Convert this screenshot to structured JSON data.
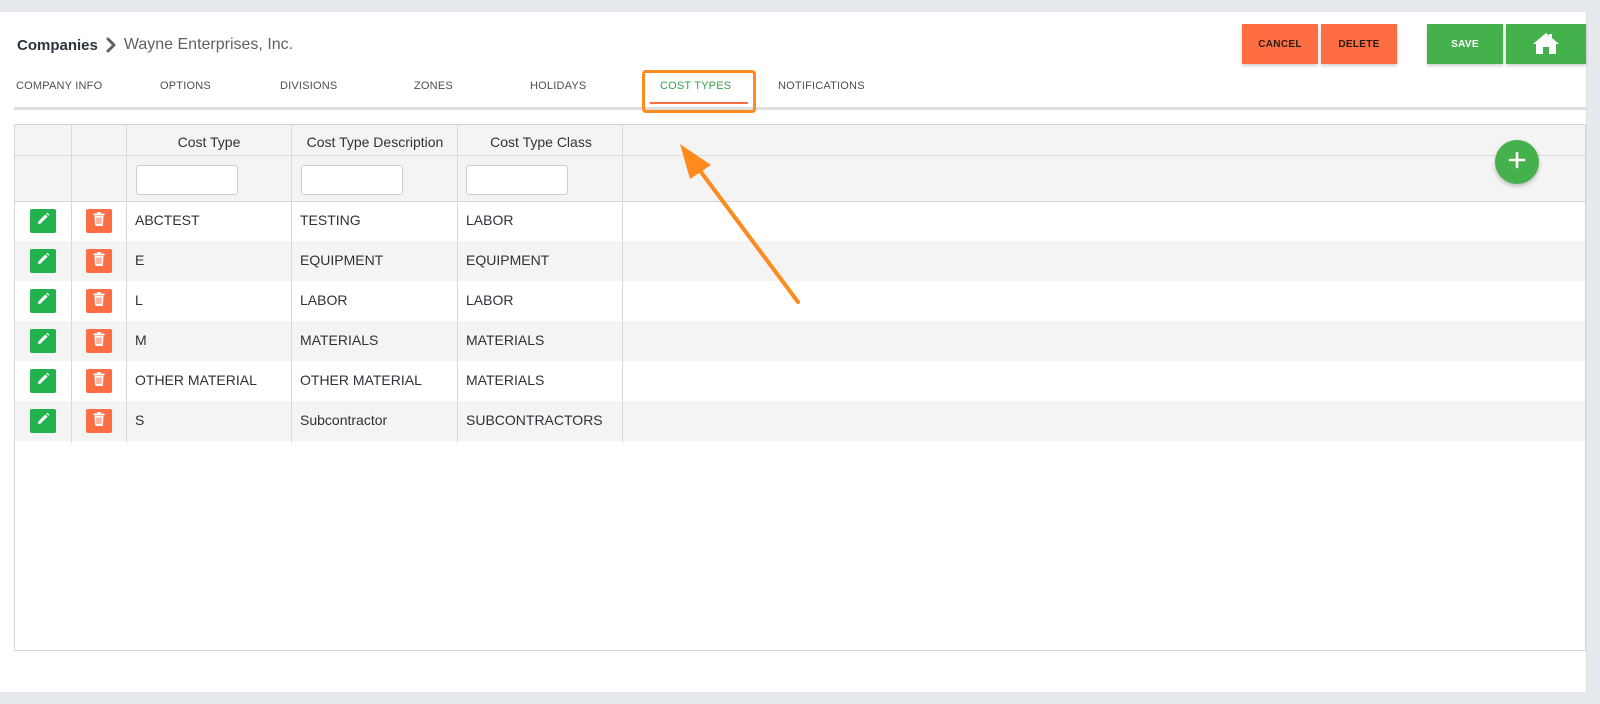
{
  "breadcrumb": {
    "root": "Companies",
    "current": "Wayne Enterprises, Inc."
  },
  "toolbar": {
    "cancel_label": "CANCEL",
    "delete_label": "DELETE",
    "save_label": "SAVE"
  },
  "tabs": [
    {
      "label": "COMPANY INFO"
    },
    {
      "label": "OPTIONS"
    },
    {
      "label": "DIVISIONS"
    },
    {
      "label": "ZONES"
    },
    {
      "label": "HOLIDAYS"
    },
    {
      "label": "COST TYPES",
      "active": true
    },
    {
      "label": "NOTIFICATIONS"
    }
  ],
  "table": {
    "columns": [
      "Cost Type",
      "Cost Type Description",
      "Cost Type Class"
    ],
    "rows": [
      {
        "cost_type": "ABCTEST",
        "description": "TESTING",
        "class": "LABOR"
      },
      {
        "cost_type": "E",
        "description": "EQUIPMENT",
        "class": "EQUIPMENT"
      },
      {
        "cost_type": "L",
        "description": "LABOR",
        "class": "LABOR"
      },
      {
        "cost_type": "M",
        "description": "MATERIALS",
        "class": "MATERIALS"
      },
      {
        "cost_type": "OTHER MATERIAL",
        "description": "OTHER MATERIAL",
        "class": "MATERIALS"
      },
      {
        "cost_type": "S",
        "description": "Subcontractor",
        "class": "SUBCONTRACTORS"
      }
    ]
  },
  "icons": {
    "breadcrumb_separator": "chevron-right-icon",
    "home": "home-icon",
    "edit": "pencil-icon",
    "delete": "trash-icon",
    "add": "plus-icon"
  },
  "colors": {
    "accent_green": "#45b14c",
    "danger_orange": "#ff6e42",
    "edit_green": "#22b14c",
    "annotation_orange": "#ff8a1d"
  }
}
